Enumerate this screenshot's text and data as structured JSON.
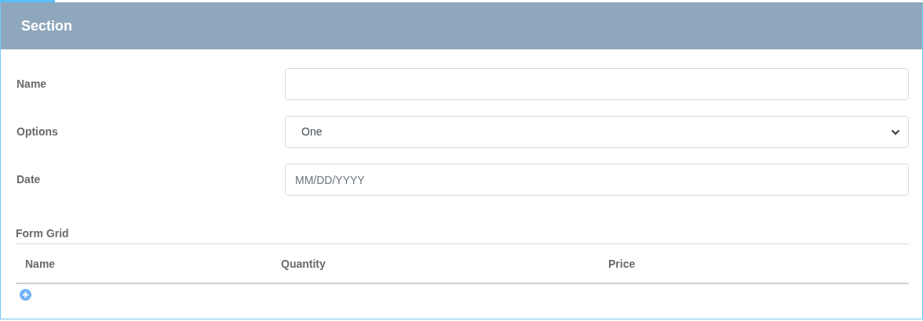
{
  "section": {
    "title": "Section"
  },
  "fields": [
    {
      "kind": "text",
      "label": "Name"
    },
    {
      "kind": "select",
      "label": "Options",
      "value": "One"
    },
    {
      "kind": "date",
      "label": "Date",
      "placeholder": "MM/DD/YYYY"
    }
  ],
  "grid": {
    "title": "Form Grid",
    "columns": [
      "Name",
      "Quantity",
      "Price"
    ]
  }
}
